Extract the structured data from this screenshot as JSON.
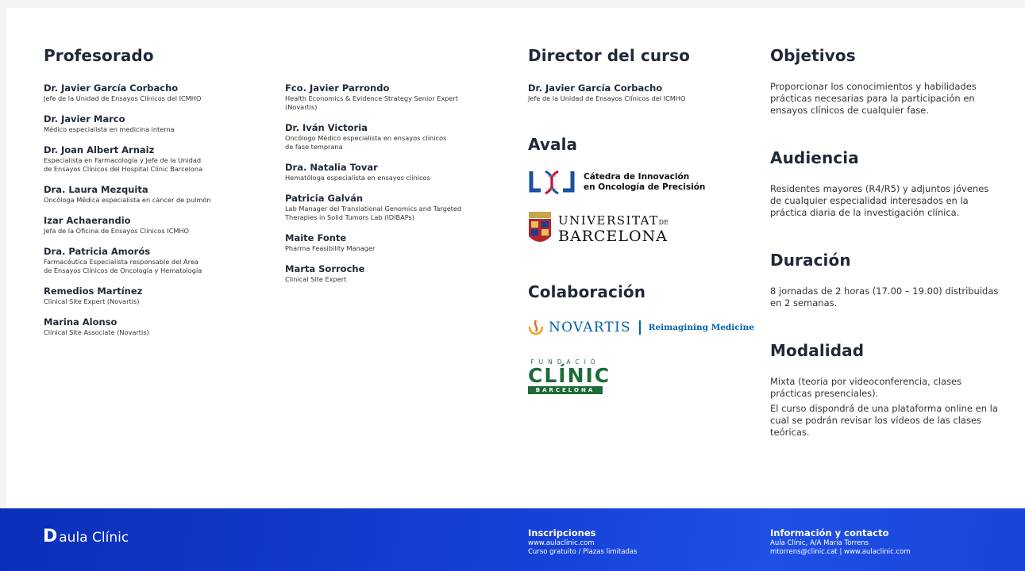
{
  "profesorado": {
    "title": "Profesorado",
    "col1": [
      {
        "name": "Dr. Javier García Corbacho",
        "role": "Jefe de la Unidad de Ensayos Clínicos del ICMHO"
      },
      {
        "name": "Dr. Javier Marco",
        "role": "Médico especialista en medicina interna"
      },
      {
        "name": "Dr. Joan Albert Arnaiz",
        "role": "Especialista en Farmacología y Jefe de la Unidad\nde Ensayos Clínicos del Hospital Clínic Barcelona"
      },
      {
        "name": "Dra. Laura Mezquita",
        "role": "Oncóloga Médica especialista en cáncer de pulmón"
      },
      {
        "name": "Izar Achaerandio",
        "role": "Jefa de la Oficina de Ensayos Clínicos ICMHO"
      },
      {
        "name": "Dra. Patricia Amorós",
        "role": "Farmacéutica Especialista responsable del Área\nde Ensayos Clínicos de Oncología y Hematología"
      },
      {
        "name": "Remedios Martínez",
        "role": "Clinical Site Expert (Novartis)"
      },
      {
        "name": "Marina Alonso",
        "role": "Clinical Site Associate (Novartis)"
      }
    ],
    "col2": [
      {
        "name": "Fco. Javier Parrondo",
        "role": "Health Economics & Evidence Strategy Senior Expert\n(Novartis)"
      },
      {
        "name": "Dr. Iván Victoria",
        "role": "Oncólogo Médico especialista en ensayos clínicos\nde fase temprana"
      },
      {
        "name": "Dra. Natalia Tovar",
        "role": "Hematóloga especialista en ensayos clínicos"
      },
      {
        "name": "Patricia Galván",
        "role": "Lab Manager del Translational Genomics and Targeted\nTherapies in Solid Tumors Lab (IDIBAPs)"
      },
      {
        "name": "Maite Fonte",
        "role": "Pharma Feasibility Manager"
      },
      {
        "name": "Marta Sorroche",
        "role": "Clinical Site Expert"
      }
    ]
  },
  "director": {
    "title": "Director del curso",
    "name": "Dr. Javier García Corbacho",
    "role": "Jefe de la Unidad de Ensayos Clínicos del ICMHO"
  },
  "avala": {
    "title": "Avala",
    "catedra_text": "Cátedra de Innovación\nen Oncología de Precisión",
    "ub_line1": "UNIVERSITAT",
    "ub_de": "DE",
    "ub_line2": "BARCELONA"
  },
  "colaboracion": {
    "title": "Colaboración",
    "novartis": "NOVARTIS",
    "novartis_tag": "Reimagining Medicine",
    "fundacio": "FUNDACIÓ",
    "clinic": "CLÍNIC",
    "barcelona": "BARCELONA"
  },
  "objetivos": {
    "title": "Objetivos",
    "text": "Proporcionar los conocimientos y habilidades prácticas necesarias para la participación en ensayos clínicos de cualquier fase."
  },
  "audiencia": {
    "title": "Audiencia",
    "text": "Residentes mayores (R4/R5) y adjuntos jóvenes de cualquier especialidad interesados en la práctica diaria de la investigación clínica."
  },
  "duracion": {
    "title": "Duración",
    "text": "8 jornadas de 2 horas (17.00 – 19.00) distribuidas en 2 semanas."
  },
  "modalidad": {
    "title": "Modalidad",
    "text1": "Mixta (teoría por videoconferencia, clases prácticas presenciales).",
    "text2": "El curso dispondrá de una plataforma online en la cual se podrán revisar los vídeos de las clases teóricas."
  },
  "footer": {
    "brand_initial": "D",
    "brand_rest": "aula Clínic",
    "inscripciones_title": "Inscripciones",
    "inscripciones_l1": "www.aulaclinic.com",
    "inscripciones_l2": "Curso gratuito / Plazas limitadas",
    "info_title": "Información y contacto",
    "info_l1": "Aula Clínic, A/A Maria Torrens",
    "info_l2": "mtorrens@clinic.cat | www.aulaclinic.com",
    "bg_color": "#1238c8"
  },
  "colors": {
    "heading": "#1f2937",
    "novartis_blue": "#0460a9",
    "clinic_green": "#1d6b38"
  }
}
